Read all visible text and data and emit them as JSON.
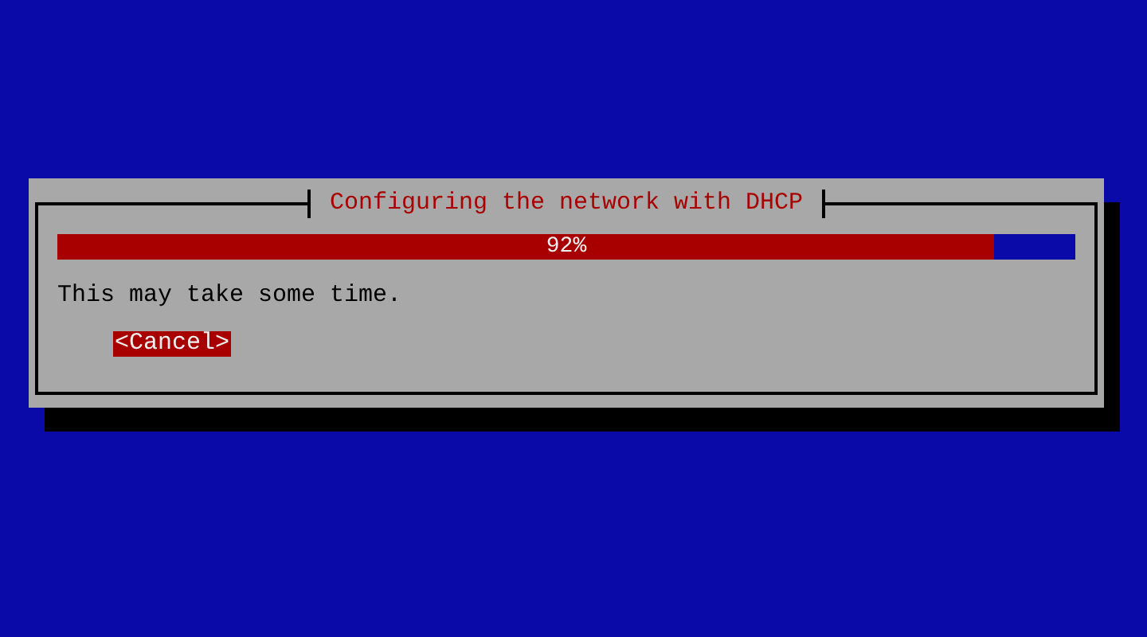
{
  "dialog": {
    "title": "Configuring the network with DHCP",
    "progress": {
      "level": 0.92,
      "reading": "92%"
    },
    "message": "This may take some time.",
    "buttons": [
      {
        "label": "<Cancel>",
        "selected": true
      }
    ]
  }
}
